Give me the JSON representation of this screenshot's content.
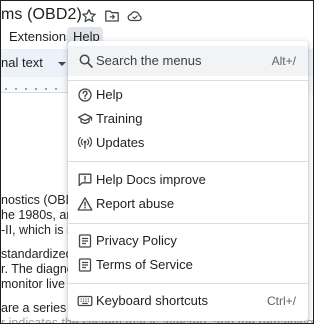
{
  "titlebar": {
    "doc_title": "ms (OBD2)",
    "icons": [
      "star-icon",
      "move-to-folder-icon",
      "cloud-saved-icon"
    ]
  },
  "menubar": {
    "extensions_label": "Extensions",
    "help_label": "Help"
  },
  "toolbar": {
    "style_value": "nal text"
  },
  "document": {
    "lines": [
      "nostics (OBD",
      "he 1980s, and",
      "-II, which is re",
      "standardized",
      "r. The diagnos",
      "monitor live da",
      "are a series o",
      "r indicates the system that is affected, and the remaining four d"
    ]
  },
  "help_menu": {
    "search": {
      "label": "Search the menus",
      "shortcut": "Alt+/",
      "icon": "search-icon"
    },
    "items": [
      {
        "label": "Help",
        "icon": "help-circle-icon",
        "shortcut": ""
      },
      {
        "label": "Training",
        "icon": "graduation-cap-icon",
        "shortcut": ""
      },
      {
        "label": "Updates",
        "icon": "broadcast-icon",
        "shortcut": ""
      },
      {
        "label": "Help Docs improve",
        "icon": "feedback-icon",
        "shortcut": ""
      },
      {
        "label": "Report abuse",
        "icon": "warning-icon",
        "shortcut": ""
      },
      {
        "label": "Privacy Policy",
        "icon": "document-icon",
        "shortcut": ""
      },
      {
        "label": "Terms of Service",
        "icon": "document-icon",
        "shortcut": ""
      },
      {
        "label": "Keyboard shortcuts",
        "icon": "keyboard-icon",
        "shortcut": "Ctrl+/"
      }
    ]
  },
  "colors": {
    "menu_highlight": "#f1f3f4",
    "help_active_bg": "#e1e5ea",
    "toolbar_bg": "#edf2fa",
    "separator": "#dadce0"
  }
}
